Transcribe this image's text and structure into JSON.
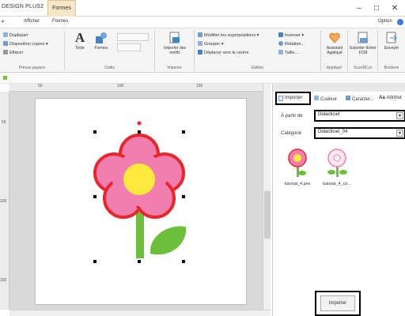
{
  "titlebar": {
    "app_title": "DESIGN PLUS2",
    "context_tab": "Formes",
    "minimize": "–",
    "maximize": "□",
    "close": "✕"
  },
  "menu": {
    "tabs": [
      "Afficher",
      "Formes"
    ],
    "right": "Option"
  },
  "ribbon": {
    "presse_papiers": {
      "label": "Presse-papiers",
      "items": [
        "Dupliquer",
        "Disposition copies",
        "Effacer"
      ]
    },
    "outils": {
      "label": "Outils",
      "texte": "Texte",
      "formes": "Formes"
    },
    "importer": {
      "label": "Importer",
      "button": "Importer des motifs"
    },
    "edition": {
      "label": "Edition",
      "items": [
        "Modifier les superpositions",
        "Grouper",
        "Déplacer vers le centre",
        "Inverser",
        "Rotation...",
        "Taille..."
      ]
    },
    "applique": {
      "label": "Appliqué",
      "button": "Assistant Appliqué"
    },
    "scancut": {
      "label": "ScanNCut",
      "button": "Exporter fichier FCM"
    },
    "broderie": {
      "label": "Broderie",
      "button": "Envoyer"
    }
  },
  "ruler": {
    "labels": [
      "50",
      "100",
      "150",
      "50",
      "100",
      "150"
    ]
  },
  "panel": {
    "tabs": {
      "importer": "Importer",
      "couleur": "Couleur",
      "caracteres": "Caracter...",
      "attribut": "Attribut"
    },
    "a_partir_de_label": "À partir de",
    "a_partir_de_value": "Didacticiel",
    "categorie_label": "Catégorie",
    "categorie_value": "Didacticiel_04",
    "thumbnails": [
      "tutorial_4.pes",
      "tutorial_4_co..."
    ],
    "import_button": "Importer"
  },
  "colors": {
    "petal_outline": "#e8262c",
    "petal_fill": "#f07fb0",
    "flower_center": "#fde93b",
    "stem": "#6cbf3a",
    "handle": "#e8262c"
  }
}
